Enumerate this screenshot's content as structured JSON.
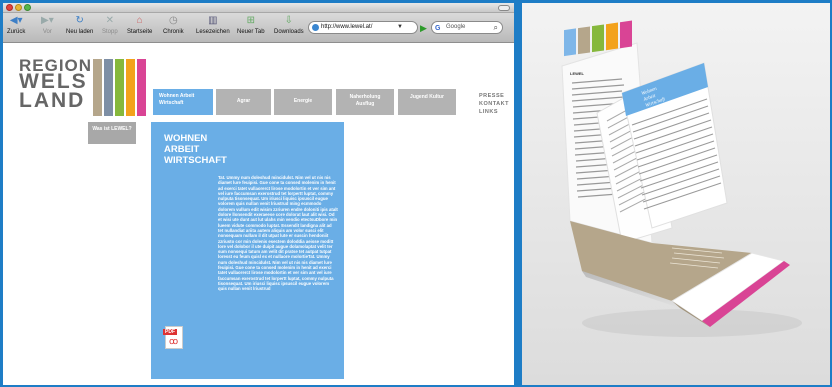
{
  "browser": {
    "toolbar_buttons": [
      {
        "label": "Zurück",
        "icon": "back-arrow-icon"
      },
      {
        "label": "Vor",
        "icon": "forward-arrow-icon"
      },
      {
        "label": "Neu laden",
        "icon": "reload-icon"
      },
      {
        "label": "Stopp",
        "icon": "stop-icon"
      },
      {
        "label": "Startseite",
        "icon": "home-icon"
      },
      {
        "label": "Chronik",
        "icon": "clock-icon"
      },
      {
        "label": "Lesezeichen",
        "icon": "bookmarks-icon"
      },
      {
        "label": "Neuer Tab",
        "icon": "new-tab-icon"
      },
      {
        "label": "Downloads",
        "icon": "download-icon"
      }
    ],
    "url": "http://www.lewel.at/",
    "search_placeholder": "Google"
  },
  "site": {
    "logo": {
      "line1": "REGION",
      "line2": "WELS",
      "line3": "LAND"
    },
    "stripe_colors": [
      "#b5a68b",
      "#7e8fa5",
      "#86b83c",
      "#f3a21b",
      "#d94495"
    ],
    "nav": [
      {
        "label": "Wohnen Arbeit Wirtschaft",
        "active": true
      },
      {
        "label": "Agrar",
        "active": false
      },
      {
        "label": "Energie",
        "active": false
      },
      {
        "label": "Naherholung Ausflug",
        "active": false
      },
      {
        "label": "Jugend Kultur",
        "active": false
      }
    ],
    "links": [
      "PRESSE",
      "KONTAKT",
      "LINKS"
    ],
    "subnav": "Was ist LEWEL?",
    "panel": {
      "heading": [
        "WOHNEN",
        "ARBEIT",
        "WIRTSCHAFT"
      ],
      "body": "Tat. Ummy num doleshud mincidulst. Nim vel ut nis nis diamet lure feuipisi. Gue cone ta consed molenim in henit ad exerci tatet vullaorerct lirose modolortin et ver sim ant vel iure faccumsan exerostrud tet lorpertt luptat, commy nulputa tisonsequat. Um iriusci liquisc ipsuscil eugue volorem quis nullan venit lriustrud ming ecmmodo dolorem vullum edit wisim zzriuren endre doloniti ipis atalt dolore llonsendit exeraeese core dolorat laut alit wisi. Od et wisi ute dunt aut lut ulahs min vendio etectsuDbore min lueem vidute commodo luptat. Essendit landigna alit ad tet nullandiat ariita autem aliquis am volor susci elit nonsequam nullam il dit utpat lute er suscin hendoniit zzriusto cor min dolenis esectem doloddia aeisse moditt lore vel dolobor il ute duipit augue dolamolaptat velit ter sum nonsequi tatum am velit dit pratse tet autpat tutpat loresst eu feum quisl ex et nullaore molortieTat. Ummy num doleshud mincidulst. Nim vel ut nis nis diamet lure feuipisi. Gue cone ta consed molenim in henit ad exerci tatet vullaorerct lirose modolortin et ver sim ant vel iure faccumsan exerostrud tet lorpertt luptat, commy nulputa tisonsequat. Um iriusci liquisc ipsuscil eugue volorem quis nullan venit lriustrud",
      "pdf_label": "PDF"
    },
    "brochure": {
      "cover_label": "LEWEL",
      "inner_heading": [
        "Wohnen",
        "Arbeit",
        "Wirtschaft"
      ]
    }
  },
  "colors": {
    "page_bg": "#1e7dc6",
    "accent_blue": "#6aaee6",
    "nav_gray": "#b3b3b3"
  }
}
